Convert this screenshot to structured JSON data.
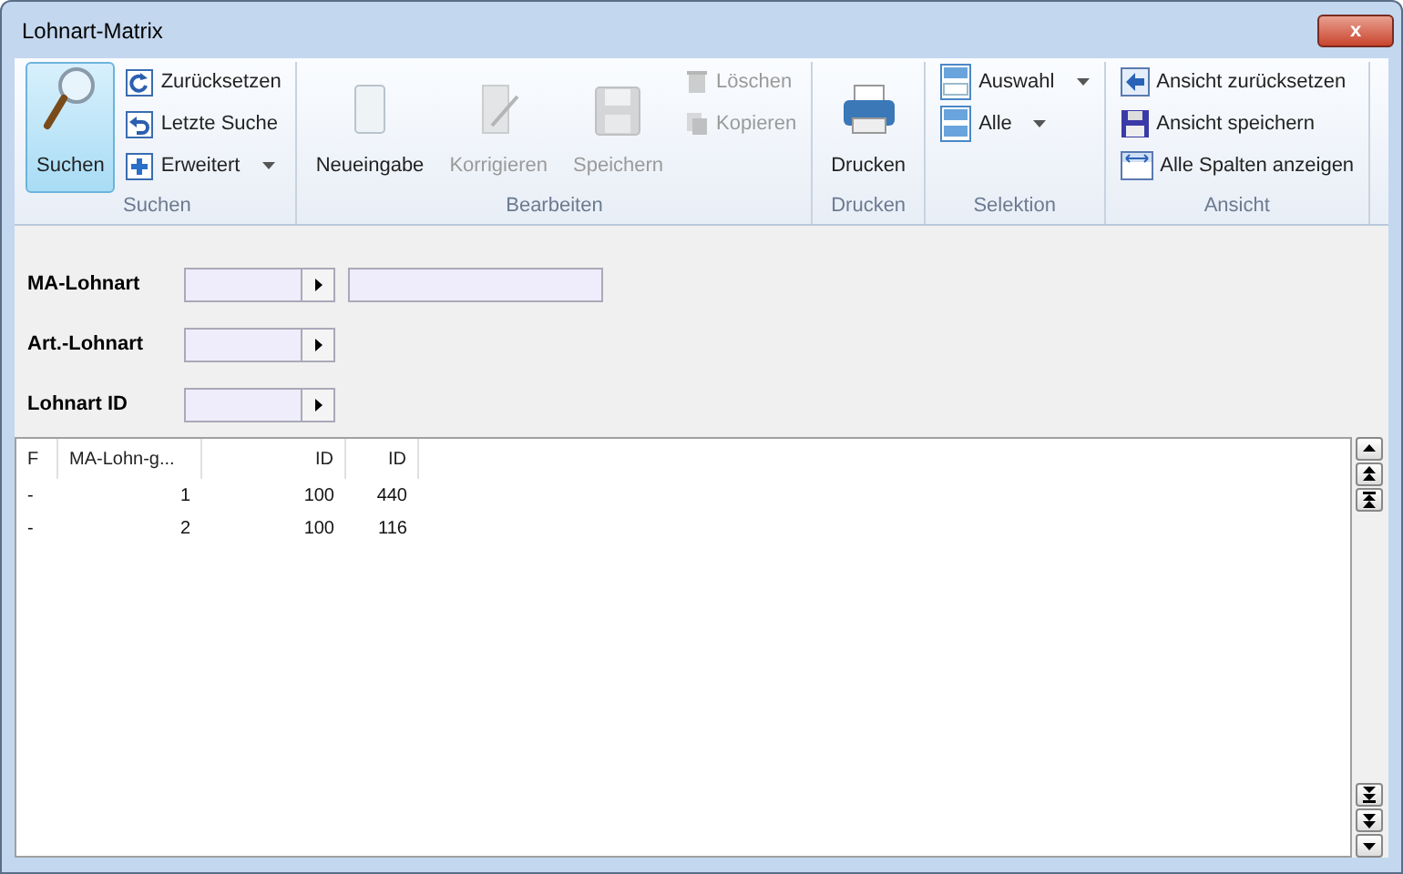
{
  "window": {
    "title": "Lohnart-Matrix",
    "close": "x"
  },
  "ribbon": {
    "groups": [
      {
        "label": "Suchen",
        "items": [
          {
            "label": "Suchen",
            "kind": "large",
            "selected": true,
            "disabled": false
          },
          {
            "label": "Zurücksetzen",
            "kind": "small",
            "disabled": false
          },
          {
            "label": "Letzte Suche",
            "kind": "small",
            "disabled": false
          },
          {
            "label": "Erweitert",
            "kind": "menu",
            "disabled": false
          }
        ]
      },
      {
        "label": "Bearbeiten",
        "items": [
          {
            "label": "Neueingabe",
            "kind": "large",
            "selected": false,
            "disabled": false
          },
          {
            "label": "Korrigieren",
            "kind": "large",
            "selected": false,
            "disabled": true
          },
          {
            "label": "Speichern",
            "kind": "large",
            "selected": false,
            "disabled": true
          },
          {
            "label": "Löschen",
            "kind": "small",
            "disabled": true
          },
          {
            "label": "Kopieren",
            "kind": "small",
            "disabled": true
          }
        ]
      },
      {
        "label": "Drucken",
        "items": [
          {
            "label": "Drucken",
            "kind": "large",
            "selected": false,
            "disabled": false
          }
        ]
      },
      {
        "label": "Selektion",
        "items": [
          {
            "label": "Auswahl",
            "kind": "menu",
            "disabled": false
          },
          {
            "label": "Alle",
            "kind": "menu",
            "disabled": false
          }
        ]
      },
      {
        "label": "Ansicht",
        "items": [
          {
            "label": "Ansicht zurücksetzen",
            "kind": "small",
            "disabled": false
          },
          {
            "label": "Ansicht speichern",
            "kind": "small",
            "disabled": false
          },
          {
            "label": "Alle Spalten anzeigen",
            "kind": "small",
            "disabled": false
          }
        ]
      }
    ]
  },
  "form": {
    "fields": [
      {
        "label": "MA-Lohnart",
        "kind": "combo_text"
      },
      {
        "label": "Art.-Lohnart",
        "kind": "combo"
      },
      {
        "label": "Lohnart ID",
        "kind": "combo"
      }
    ]
  },
  "table": {
    "columns": [
      "F",
      "MA-Lohn-g...",
      "ID",
      "ID"
    ],
    "rows": [
      [
        "-",
        "1",
        "100",
        "440"
      ],
      [
        "-",
        "2",
        "100",
        "116"
      ]
    ]
  }
}
